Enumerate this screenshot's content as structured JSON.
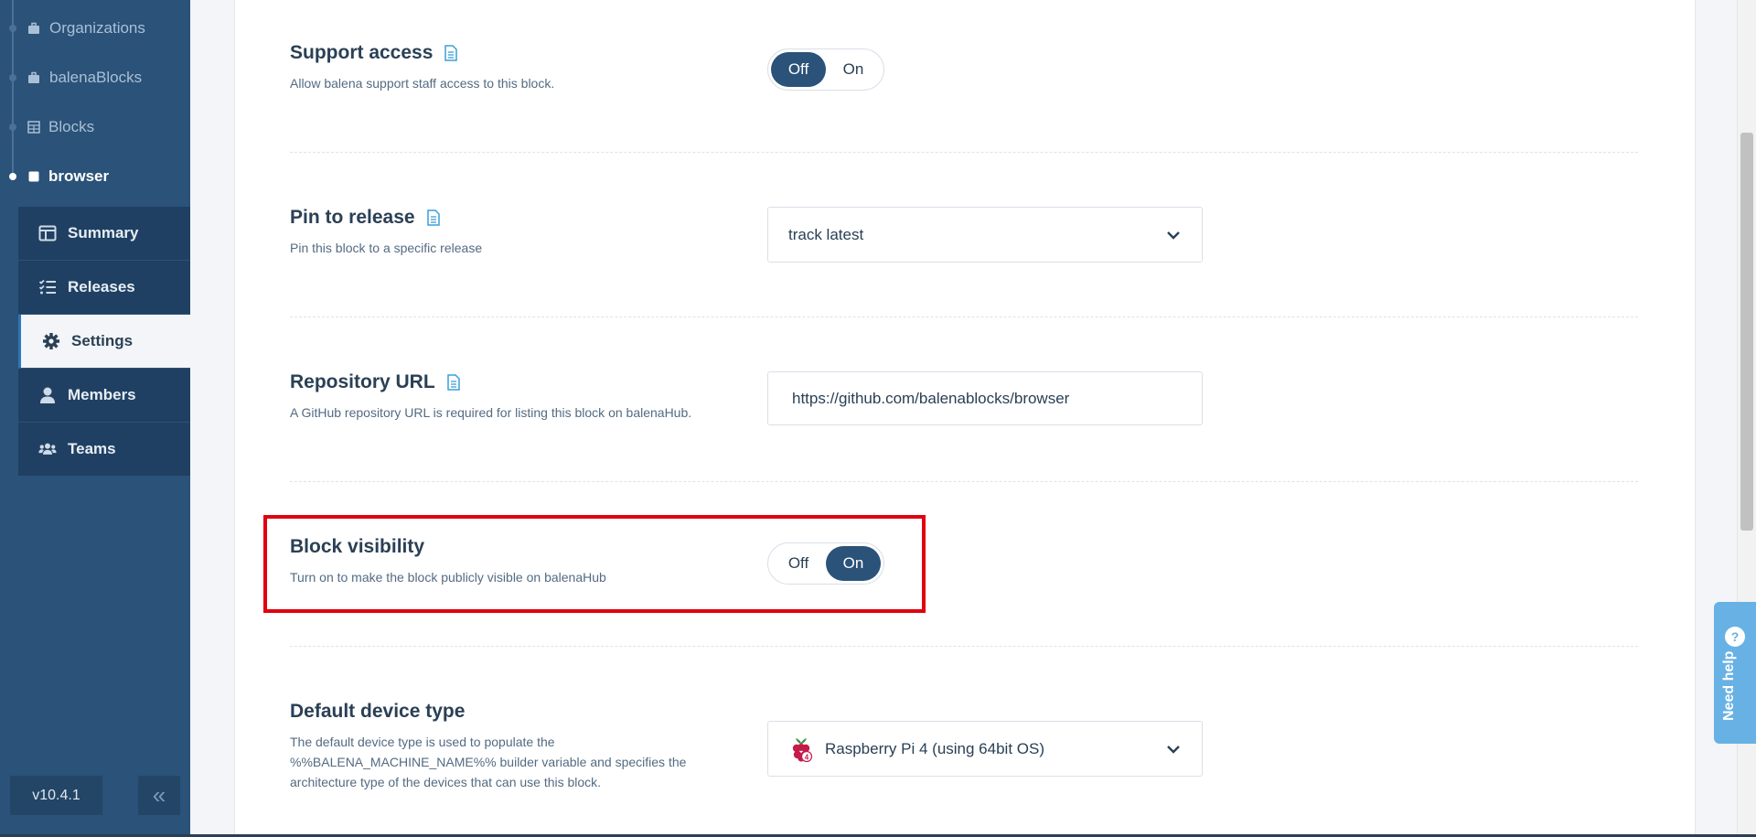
{
  "breadcrumbs": [
    {
      "label": "Organizations",
      "icon": "briefcase-icon"
    },
    {
      "label": "balenaBlocks",
      "icon": "briefcase-icon"
    },
    {
      "label": "Blocks",
      "icon": "grid-icon"
    },
    {
      "label": "browser",
      "icon": "block-icon"
    }
  ],
  "nav": [
    {
      "label": "Summary",
      "icon": "summary-icon"
    },
    {
      "label": "Releases",
      "icon": "releases-icon"
    },
    {
      "label": "Settings",
      "icon": "gear-icon"
    },
    {
      "label": "Members",
      "icon": "user-icon"
    },
    {
      "label": "Teams",
      "icon": "team-icon"
    }
  ],
  "footer": {
    "version": "v10.4.1",
    "collapse": "«"
  },
  "settings": {
    "support_access": {
      "title": "Support access",
      "description": "Allow balena support staff access to this block.",
      "off_label": "Off",
      "on_label": "On",
      "selected": "Off"
    },
    "pin_release": {
      "title": "Pin to release",
      "description": "Pin this block to a specific release",
      "value": "track latest"
    },
    "repository_url": {
      "title": "Repository URL",
      "description": "A GitHub repository URL is required for listing this block on balenaHub.",
      "value": "https://github.com/balenablocks/browser"
    },
    "block_visibility": {
      "title": "Block visibility",
      "description": "Turn on to make the block publicly visible on balenaHub",
      "off_label": "Off",
      "on_label": "On",
      "selected": "On"
    },
    "default_device_type": {
      "title": "Default device type",
      "description": "The default device type is used to populate the %%BALENA_MACHINE_NAME%% builder variable and specifies the architecture type of the devices that can use this block.",
      "value": "Raspberry Pi 4 (using 64bit OS)"
    }
  },
  "help": {
    "label": "Need help"
  },
  "colors": {
    "sidebar": "#2b5278",
    "accent": "#2e77b8",
    "highlight": "#e0000f",
    "help": "#67b1e4"
  }
}
